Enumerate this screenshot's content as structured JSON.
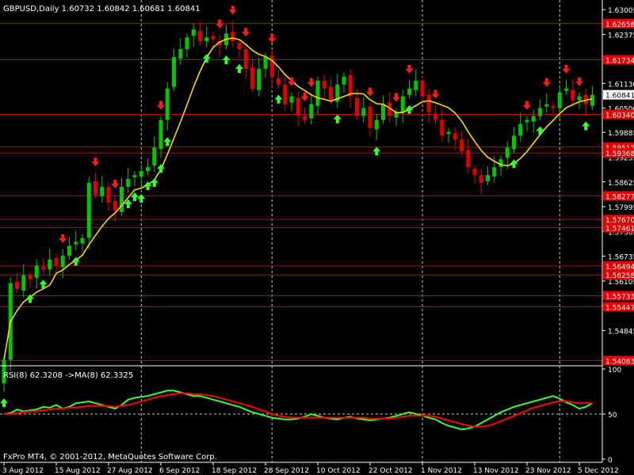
{
  "header": {
    "symbol": "GBPUSD,Daily",
    "ohlc": "1.60732 1.60842 1.60681 1.60841"
  },
  "footer": {
    "copyright": "FxPro MT4, © 2001-2012, MetaQuotes Software Corp."
  },
  "colors": {
    "background": "#000000",
    "bull_candle": "#00c800",
    "bear_candle": "#e00000",
    "ma_line": "#ffd700",
    "level_line": "#c80000",
    "level_label_bg": "#e00000",
    "axis": "#ffffff",
    "grid": "#ffffff",
    "rsi_line": "#33ff33",
    "rsi_ma_line": "#ff0000",
    "current_price_box": "#ffffff"
  },
  "chart_data": [
    {
      "type": "candlestick",
      "symbol": "GBPUSD",
      "timeframe": "Daily",
      "ylim": [
        1.5395,
        1.6325
      ],
      "price_ticks": [
        "1.63005",
        "1.62375",
        "1.61130",
        "1.60500",
        "1.59885",
        "1.59255",
        "1.58625",
        "1.57995",
        "1.57365",
        "1.56735",
        "1.56105",
        "1.55475",
        "1.54845"
      ],
      "current_price": "1.60841",
      "date_labels": [
        {
          "label": "3 Aug 2012",
          "index": 0
        },
        {
          "label": "15 Aug 2012",
          "index": 8
        },
        {
          "label": "27 Aug 2012",
          "index": 16
        },
        {
          "label": "6 Sep 2012",
          "index": 24
        },
        {
          "label": "18 Sep 2012",
          "index": 32
        },
        {
          "label": "28 Sep 2012",
          "index": 40
        },
        {
          "label": "10 Oct 2012",
          "index": 48
        },
        {
          "label": "22 Oct 2012",
          "index": 56
        },
        {
          "label": "1 Nov 2012",
          "index": 64
        },
        {
          "label": "13 Nov 2012",
          "index": 72
        },
        {
          "label": "23 Nov 2012",
          "index": 80
        },
        {
          "label": "5 Dec 2012",
          "index": 88
        }
      ],
      "vertical_grid_at": [
        21,
        41,
        64,
        85
      ],
      "levels": [
        {
          "value": 1.6265,
          "label": "1.62658"
        },
        {
          "value": 1.6173,
          "label": "1.61734"
        },
        {
          "value": 1.6034,
          "label": "1.60340"
        },
        {
          "value": 1.5951,
          "label": "1.59512"
        },
        {
          "value": 1.5936,
          "label": "1.59368"
        },
        {
          "value": 1.5827,
          "label": "1.58277"
        },
        {
          "value": 1.5767,
          "label": "1.57670"
        },
        {
          "value": 1.5746,
          "label": "1.57461"
        },
        {
          "value": 1.5649,
          "label": "1.56494"
        },
        {
          "value": 1.5626,
          "label": "1.56258"
        },
        {
          "value": 1.5573,
          "label": "1.55733"
        },
        {
          "value": 1.5545,
          "label": "1.55447"
        },
        {
          "value": 1.5408,
          "label": "1.54083"
        }
      ],
      "ma_period": 8,
      "closes": [
        1.541,
        1.5605,
        1.559,
        1.5625,
        1.5615,
        1.565,
        1.564,
        1.5665,
        1.565,
        1.5675,
        1.57,
        1.571,
        1.572,
        1.586,
        1.583,
        1.585,
        1.581,
        1.579,
        1.585,
        1.587,
        1.588,
        1.589,
        1.59,
        1.595,
        1.602,
        1.61,
        1.618,
        1.62,
        1.623,
        1.625,
        1.622,
        1.623,
        1.6225,
        1.621,
        1.624,
        1.622,
        1.62,
        1.615,
        1.61,
        1.615,
        1.618,
        1.613,
        1.611,
        1.606,
        1.608,
        1.603,
        1.602,
        1.606,
        1.612,
        1.61,
        1.607,
        1.611,
        1.613,
        1.608,
        1.603,
        1.605,
        1.6,
        1.602,
        1.606,
        1.603,
        1.604,
        1.608,
        1.61,
        1.612,
        1.608,
        1.604,
        1.602,
        1.598,
        1.599,
        1.597,
        1.594,
        1.59,
        1.588,
        1.586,
        1.588,
        1.59,
        1.592,
        1.595,
        1.598,
        1.601,
        1.602,
        1.603,
        1.605,
        1.606,
        1.605,
        1.609,
        1.61,
        1.607,
        1.608,
        1.606,
        1.6084
      ],
      "up_arrows_at": [
        0,
        4,
        6,
        11,
        19,
        20,
        21,
        22,
        23,
        24,
        25,
        31,
        34,
        36,
        42,
        51,
        57,
        62,
        78,
        82,
        89
      ],
      "down_arrows_at": [
        9,
        14,
        17,
        24,
        33,
        35,
        37,
        41,
        44,
        46,
        47,
        56,
        60,
        62,
        66,
        80,
        83,
        86,
        88
      ]
    },
    {
      "type": "line",
      "title": "RSI(8) 62.3208  ->MA(8) 62.3325",
      "ylim": [
        0,
        100
      ],
      "y_ticks": [
        "100",
        "50",
        "0"
      ],
      "reference_line": 50,
      "series": [
        {
          "name": "RSI(8)",
          "values": [
            50,
            51,
            55,
            53,
            54,
            55,
            58,
            57,
            60,
            56,
            58,
            62,
            63,
            64,
            62,
            60,
            58,
            56,
            60,
            66,
            68,
            69,
            70,
            72,
            74,
            76,
            76,
            74,
            72,
            70,
            70,
            68,
            66,
            64,
            62,
            60,
            58,
            55,
            52,
            50,
            48,
            46,
            45,
            44,
            44,
            45,
            47,
            50,
            48,
            46,
            45,
            44,
            46,
            47,
            45,
            44,
            43,
            44,
            45,
            46,
            48,
            50,
            52,
            50,
            48,
            46,
            44,
            40,
            37,
            35,
            33,
            34,
            36,
            40,
            44,
            48,
            52,
            55,
            58,
            60,
            62,
            64,
            66,
            68,
            70,
            67,
            63,
            60,
            56,
            58,
            62
          ]
        },
        {
          "name": "MA(8)",
          "values": [
            50,
            50,
            51,
            52,
            53,
            53,
            54,
            55,
            56,
            56,
            57,
            57,
            58,
            59,
            59,
            59,
            59,
            58,
            59,
            60,
            62,
            64,
            66,
            68,
            70,
            71,
            72,
            73,
            73,
            72,
            72,
            71,
            70,
            68,
            66,
            64,
            62,
            60,
            58,
            55,
            53,
            50,
            48,
            47,
            46,
            46,
            46,
            46,
            46,
            46,
            46,
            46,
            46,
            46,
            46,
            46,
            45,
            45,
            45,
            45,
            46,
            47,
            48,
            48,
            48,
            48,
            47,
            45,
            43,
            41,
            39,
            37,
            36,
            36,
            37,
            39,
            42,
            45,
            48,
            51,
            54,
            57,
            59,
            61,
            63,
            64,
            64,
            63,
            62,
            62,
            62
          ]
        }
      ]
    }
  ]
}
